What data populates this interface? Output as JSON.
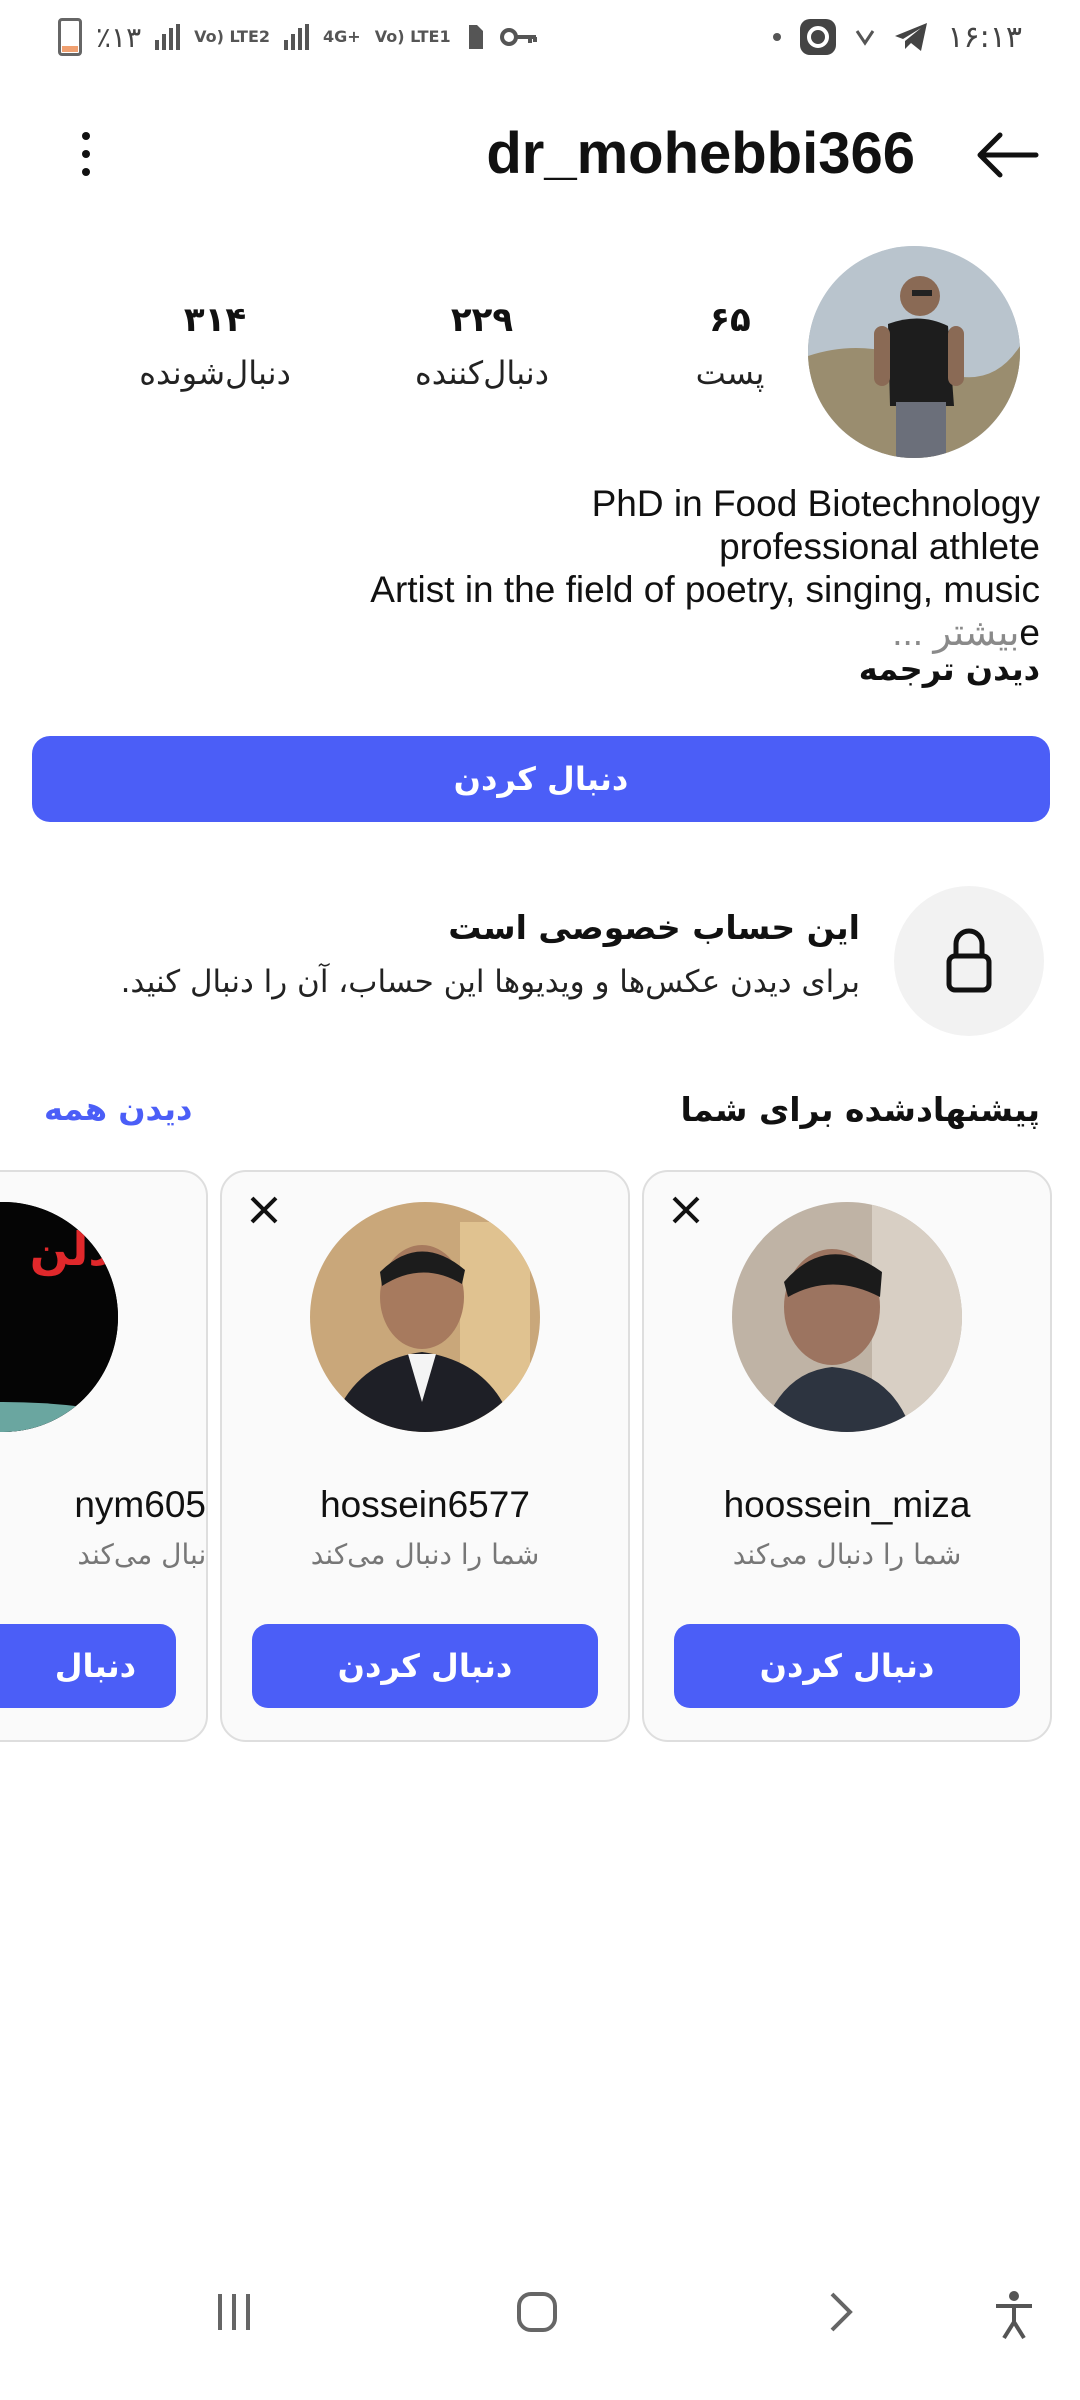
{
  "status_bar": {
    "battery_percent": "٪۱۳",
    "net1": "Vo) LTE2",
    "net2": "4G+",
    "net3": "Vo) LTE1",
    "time": "۱۶:۱۳",
    "icons": [
      "battery-icon",
      "signal-icon",
      "lte-icon",
      "signal-icon",
      "4g-icon",
      "lte-icon",
      "sim-icon",
      "key-icon",
      "dot-icon",
      "app-icon",
      "vpn-icon",
      "telegram-icon"
    ]
  },
  "header": {
    "username": "dr_mohebbi366",
    "back_icon": "arrow-back-icon",
    "menu_icon": "more-vertical-icon"
  },
  "profile": {
    "stats": [
      {
        "value": "۶۵",
        "label": "پست"
      },
      {
        "value": "۲۲۹",
        "label": "دنبال‌کننده"
      },
      {
        "value": "۳۱۴",
        "label": "دنبال‌شونده"
      }
    ],
    "bio": [
      "PhD in Food Biotechnology",
      "professional athlete",
      "Artist in the field of poetry, singing, music"
    ],
    "bio_tail": "e",
    "bio_more": "... بیشتر",
    "see_translation": "دیدن ترجمه",
    "follow_button": "دنبال کردن"
  },
  "private_notice": {
    "icon": "lock-icon",
    "title": "این حساب خصوصی است",
    "subtitle": "برای دیدن عکس‌ها و ویدیوها این حساب، آن را دنبال کنید."
  },
  "suggestions": {
    "title": "پیشنهادشده برای شما",
    "see_all": "دیدن همه",
    "cards": [
      {
        "username": "hoossein_miza",
        "subtitle": "شما را دنبال می‌کند",
        "button": "دنبال کردن"
      },
      {
        "username": "hossein6577",
        "subtitle": "شما را دنبال می‌کند",
        "button": "دنبال کردن"
      },
      {
        "username": "nym605",
        "subtitle": "شما را دنبال می‌کند",
        "button": "دنبال",
        "image_text": "دلن"
      }
    ]
  },
  "navbar": {
    "items": [
      "recent-apps-icon",
      "home-icon",
      "back-icon",
      "accessibility-icon"
    ]
  }
}
